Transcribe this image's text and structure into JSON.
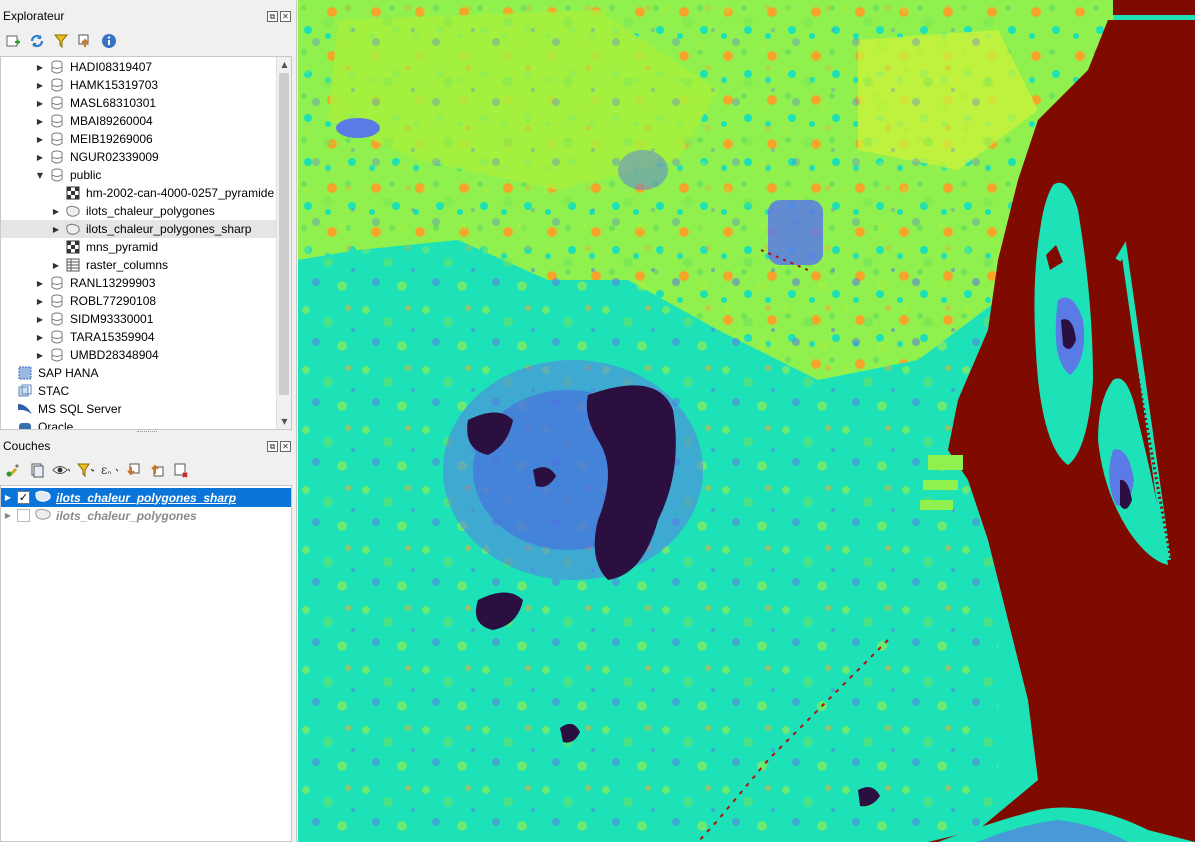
{
  "browser": {
    "title": "Explorateur",
    "items": [
      {
        "label": "HADI08319407",
        "type": "schema",
        "expandable": true
      },
      {
        "label": "HAMK15319703",
        "type": "schema",
        "expandable": true
      },
      {
        "label": "MASL68310301",
        "type": "schema",
        "expandable": true
      },
      {
        "label": "MBAI89260004",
        "type": "schema",
        "expandable": true
      },
      {
        "label": "MEIB19269006",
        "type": "schema",
        "expandable": true
      },
      {
        "label": "NGUR02339009",
        "type": "schema",
        "expandable": true
      },
      {
        "label": "public",
        "type": "schema",
        "expanded": true
      },
      {
        "label": "hm-2002-can-4000-0257_pyramide",
        "type": "raster",
        "child": true
      },
      {
        "label": "ilots_chaleur_polygones",
        "type": "polygon",
        "child": true,
        "expandable": true
      },
      {
        "label": "ilots_chaleur_polygones_sharp",
        "type": "polygon",
        "child": true,
        "expandable": true,
        "selected": true
      },
      {
        "label": "mns_pyramid",
        "type": "raster",
        "child": true
      },
      {
        "label": "raster_columns",
        "type": "table",
        "child": true,
        "expandable": true
      },
      {
        "label": "RANL13299903",
        "type": "schema",
        "expandable": true
      },
      {
        "label": "ROBL77290108",
        "type": "schema",
        "expandable": true
      },
      {
        "label": "SIDM93330001",
        "type": "schema",
        "expandable": true
      },
      {
        "label": "TARA15359904",
        "type": "schema",
        "expandable": true
      },
      {
        "label": "UMBD28348904",
        "type": "schema",
        "expandable": true
      }
    ],
    "providers": [
      {
        "label": "SAP HANA",
        "icon": "sap-hana-icon"
      },
      {
        "label": "STAC",
        "icon": "stac-icon"
      },
      {
        "label": "MS SQL Server",
        "icon": "mssql-icon"
      },
      {
        "label": "Oracle",
        "icon": "oracle-icon"
      }
    ]
  },
  "layers": {
    "title": "Couches",
    "items": [
      {
        "label": "ilots_chaleur_polygones_sharp",
        "checked": true,
        "active": true
      },
      {
        "label": "ilots_chaleur_polygones",
        "checked": false,
        "active": false
      }
    ]
  },
  "colors": {
    "selection_blue": "#0a74d8",
    "map_dark_red": "#7f0a00",
    "map_cyan": "#1de2b8",
    "map_green_yellow": "#a8f03c",
    "map_blue": "#5a7ae6",
    "map_dark_navy": "#2b0f40",
    "map_orange": "#f5a62a"
  }
}
